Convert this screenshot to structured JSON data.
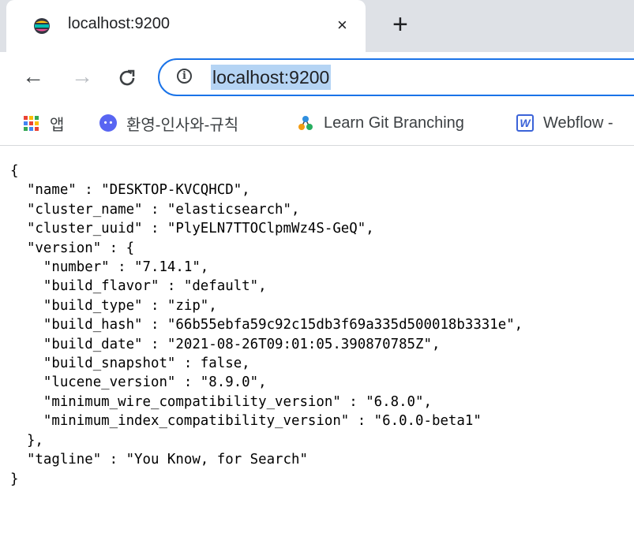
{
  "tab": {
    "title": "localhost:9200",
    "close_glyph": "×",
    "new_tab_glyph": "+",
    "favicon": "elastic-icon"
  },
  "toolbar": {
    "back_glyph": "←",
    "forward_glyph": "→",
    "reload_glyph": "C",
    "info_glyph": "i",
    "url": "localhost:9200"
  },
  "bookmarks": [
    {
      "label": "앱",
      "icon": "apps-grid-icon"
    },
    {
      "label": "환영-인사와-규칙",
      "icon": "discord-icon"
    },
    {
      "label": "Learn Git Branching",
      "icon": "git-branch-icon"
    },
    {
      "label": "Webflow -",
      "icon": "webflow-icon"
    }
  ],
  "json_lines": [
    "{",
    "  \"name\" : \"DESKTOP-KVCQHCD\",",
    "  \"cluster_name\" : \"elasticsearch\",",
    "  \"cluster_uuid\" : \"PlyELN7TTOClpmWz4S-GeQ\",",
    "  \"version\" : {",
    "    \"number\" : \"7.14.1\",",
    "    \"build_flavor\" : \"default\",",
    "    \"build_type\" : \"zip\",",
    "    \"build_hash\" : \"66b55ebfa59c92c15db3f69a335d500018b3331e\",",
    "    \"build_date\" : \"2021-08-26T09:01:05.390870785Z\",",
    "    \"build_snapshot\" : false,",
    "    \"lucene_version\" : \"8.9.0\",",
    "    \"minimum_wire_compatibility_version\" : \"6.8.0\",",
    "    \"minimum_index_compatibility_version\" : \"6.0.0-beta1\"",
    "  },",
    "  \"tagline\" : \"You Know, for Search\"",
    "}"
  ]
}
